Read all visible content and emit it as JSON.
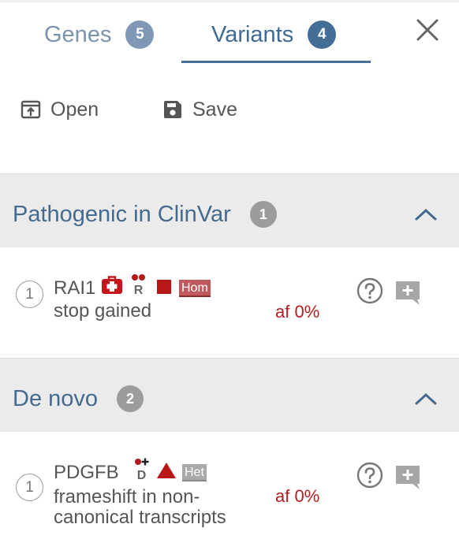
{
  "tabs": [
    {
      "label": "Genes",
      "count": "5"
    },
    {
      "label": "Variants",
      "count": "4"
    }
  ],
  "toolbar": {
    "open_label": "Open",
    "save_label": "Save"
  },
  "sections": [
    {
      "title": "Pathogenic in ClinVar",
      "count": "1",
      "variants": [
        {
          "index": "1",
          "gene": "RAI1",
          "effect": "stop gained",
          "af": "af 0%",
          "zygosity": "Hom",
          "inheritance_letter": "R",
          "clinvar_icon": "medical-kit-icon",
          "impact_icon": "square-high-impact-icon"
        }
      ]
    },
    {
      "title": "De novo",
      "count": "2",
      "variants": [
        {
          "index": "1",
          "gene": "PDGFB",
          "effect": "frameshift in non-canonical transcripts",
          "af": "af 0%",
          "zygosity": "Het",
          "inheritance_letter": "D",
          "impact_icon": "triangle-high-impact-icon"
        }
      ]
    }
  ],
  "colors": {
    "accent": "#45709a",
    "pathogenic_red": "#c3151b",
    "af_red": "#b21d1d",
    "header_gray": "#ebebeb"
  }
}
